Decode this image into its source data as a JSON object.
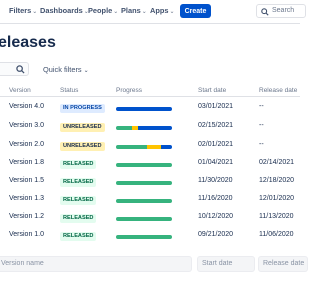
{
  "nav": {
    "items": [
      {
        "label": "Filters"
      },
      {
        "label": "Dashboards"
      },
      {
        "label": "People"
      },
      {
        "label": "Plans"
      },
      {
        "label": "Apps"
      }
    ],
    "create_label": "Create",
    "search_placeholder": "Search"
  },
  "page": {
    "title": "eleases",
    "quick_filters_label": "Quick filters"
  },
  "table": {
    "columns": {
      "version": "Version",
      "status": "Status",
      "progress": "Progress",
      "start_date": "Start date",
      "release_date": "Release date"
    },
    "rows": [
      {
        "version": "Version 4.0",
        "status": "IN PROGRESS",
        "status_type": "inprogress",
        "progress": {
          "done": 0,
          "in_progress": 0,
          "todo": 1.0
        },
        "start_date": "03/01/2021",
        "release_date": "--"
      },
      {
        "version": "Version 3.0",
        "status": "UNRELEASED",
        "status_type": "unreleased",
        "progress": {
          "done": 0.28,
          "in_progress": 0.12,
          "todo": 0.6
        },
        "start_date": "02/15/2021",
        "release_date": "--"
      },
      {
        "version": "Version 2.0",
        "status": "UNRELEASED",
        "status_type": "unreleased",
        "progress": {
          "done": 0.55,
          "in_progress": 0.25,
          "todo": 0.2
        },
        "start_date": "02/01/2021",
        "release_date": "--"
      },
      {
        "version": "Version 1.8",
        "status": "RELEASED",
        "status_type": "released",
        "progress": {
          "done": 1.0,
          "in_progress": 0,
          "todo": 0
        },
        "start_date": "01/04/2021",
        "release_date": "02/14/2021"
      },
      {
        "version": "Version 1.5",
        "status": "RELEASED",
        "status_type": "released",
        "progress": {
          "done": 1.0,
          "in_progress": 0,
          "todo": 0
        },
        "start_date": "11/30/2020",
        "release_date": "12/18/2020"
      },
      {
        "version": "Version 1.3",
        "status": "RELEASED",
        "status_type": "released",
        "progress": {
          "done": 1.0,
          "in_progress": 0,
          "todo": 0
        },
        "start_date": "11/16/2020",
        "release_date": "12/01/2020"
      },
      {
        "version": "Version 1.2",
        "status": "RELEASED",
        "status_type": "released",
        "progress": {
          "done": 1.0,
          "in_progress": 0,
          "todo": 0
        },
        "start_date": "10/12/2020",
        "release_date": "11/13/2020"
      },
      {
        "version": "Version 1.0",
        "status": "RELEASED",
        "status_type": "released",
        "progress": {
          "done": 1.0,
          "in_progress": 0,
          "todo": 0
        },
        "start_date": "09/21/2020",
        "release_date": "11/06/2020"
      }
    ]
  },
  "new_version": {
    "name_placeholder": "Version name",
    "start_placeholder": "Start date",
    "release_placeholder": "Release date"
  },
  "colors": {
    "brand": "#0052cc",
    "done": "#36b37e",
    "in_progress": "#ffc400",
    "todo": "#0052cc",
    "lozenge_inprogress_bg": "#deebff",
    "lozenge_inprogress_fg": "#0747a6",
    "lozenge_unreleased_bg": "#fff0b3",
    "lozenge_unreleased_fg": "#172b4d",
    "lozenge_released_bg": "#e3fcef",
    "lozenge_released_fg": "#006644"
  }
}
